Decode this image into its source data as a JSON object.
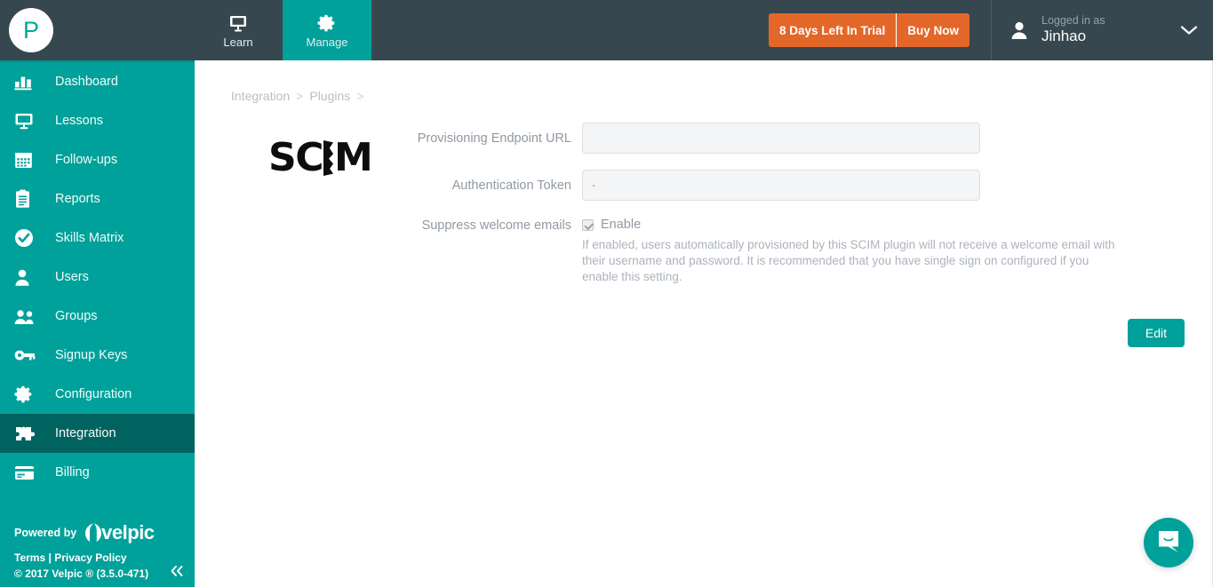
{
  "topbar": {
    "brand_initial": "P",
    "nav": [
      {
        "label": "Learn",
        "icon": "monitor-icon",
        "active": false
      },
      {
        "label": "Manage",
        "icon": "gear-icon",
        "active": true
      }
    ],
    "trial": {
      "days_label": "8 Days Left In Trial",
      "buy_label": "Buy Now",
      "color": "#e4672a"
    },
    "user": {
      "logged_in_label": "Logged in as",
      "name": "Jinhao",
      "icon": "person-icon",
      "chevron": "chevron-down-icon"
    },
    "background": "#37474f"
  },
  "sidebar": {
    "accent": "#00a19a",
    "active_background": "#00635f",
    "items": [
      {
        "label": "Dashboard",
        "icon": "bar-chart-icon",
        "active": false
      },
      {
        "label": "Lessons",
        "icon": "monitor-icon",
        "active": false
      },
      {
        "label": "Follow-ups",
        "icon": "calendar-icon",
        "active": false
      },
      {
        "label": "Reports",
        "icon": "clipboard-icon",
        "active": false
      },
      {
        "label": "Skills Matrix",
        "icon": "check-circle-icon",
        "active": false
      },
      {
        "label": "Users",
        "icon": "person-icon",
        "active": false
      },
      {
        "label": "Groups",
        "icon": "people-icon",
        "active": false
      },
      {
        "label": "Signup Keys",
        "icon": "key-icon",
        "active": false
      },
      {
        "label": "Configuration",
        "icon": "gear-icon",
        "active": false
      },
      {
        "label": "Integration",
        "icon": "puzzle-icon",
        "active": true
      },
      {
        "label": "Billing",
        "icon": "credit-card-icon",
        "active": false
      }
    ],
    "footer": {
      "powered_by": "Powered by",
      "brand": "velpic",
      "terms": "Terms",
      "separator": "|",
      "privacy": "Privacy Policy",
      "copyright": "© 2017 Velpic ® (3.5.0-471)",
      "collapse_icon": "double-chevron-left-icon"
    }
  },
  "main": {
    "breadcrumb": [
      {
        "label": "Integration",
        "sep": ">"
      },
      {
        "label": "Plugins",
        "sep": ">"
      }
    ],
    "plugin": {
      "logo_text_left": "SC",
      "logo_text_right": "M",
      "logo_alt": "scim-logo"
    },
    "form": {
      "fields": [
        {
          "label": "Provisioning Endpoint URL",
          "value": "",
          "placeholder": "",
          "name": "provisioning-endpoint-url-input"
        },
        {
          "label": "Authentication Token",
          "value": "·",
          "placeholder": "",
          "name": "authentication-token-input"
        }
      ],
      "checkbox": {
        "label": "Suppress welcome emails",
        "option_label": "Enable",
        "checked": true,
        "helper": "If enabled, users automatically provisioned by this SCIM plugin will not receive a welcome email with their username and password. It is recommended that you have single sign on configured if you enable this setting."
      },
      "edit_button": "Edit"
    }
  },
  "chat": {
    "launcher_icon": "chat-bubble-smile-icon",
    "color": "#00a19a"
  }
}
